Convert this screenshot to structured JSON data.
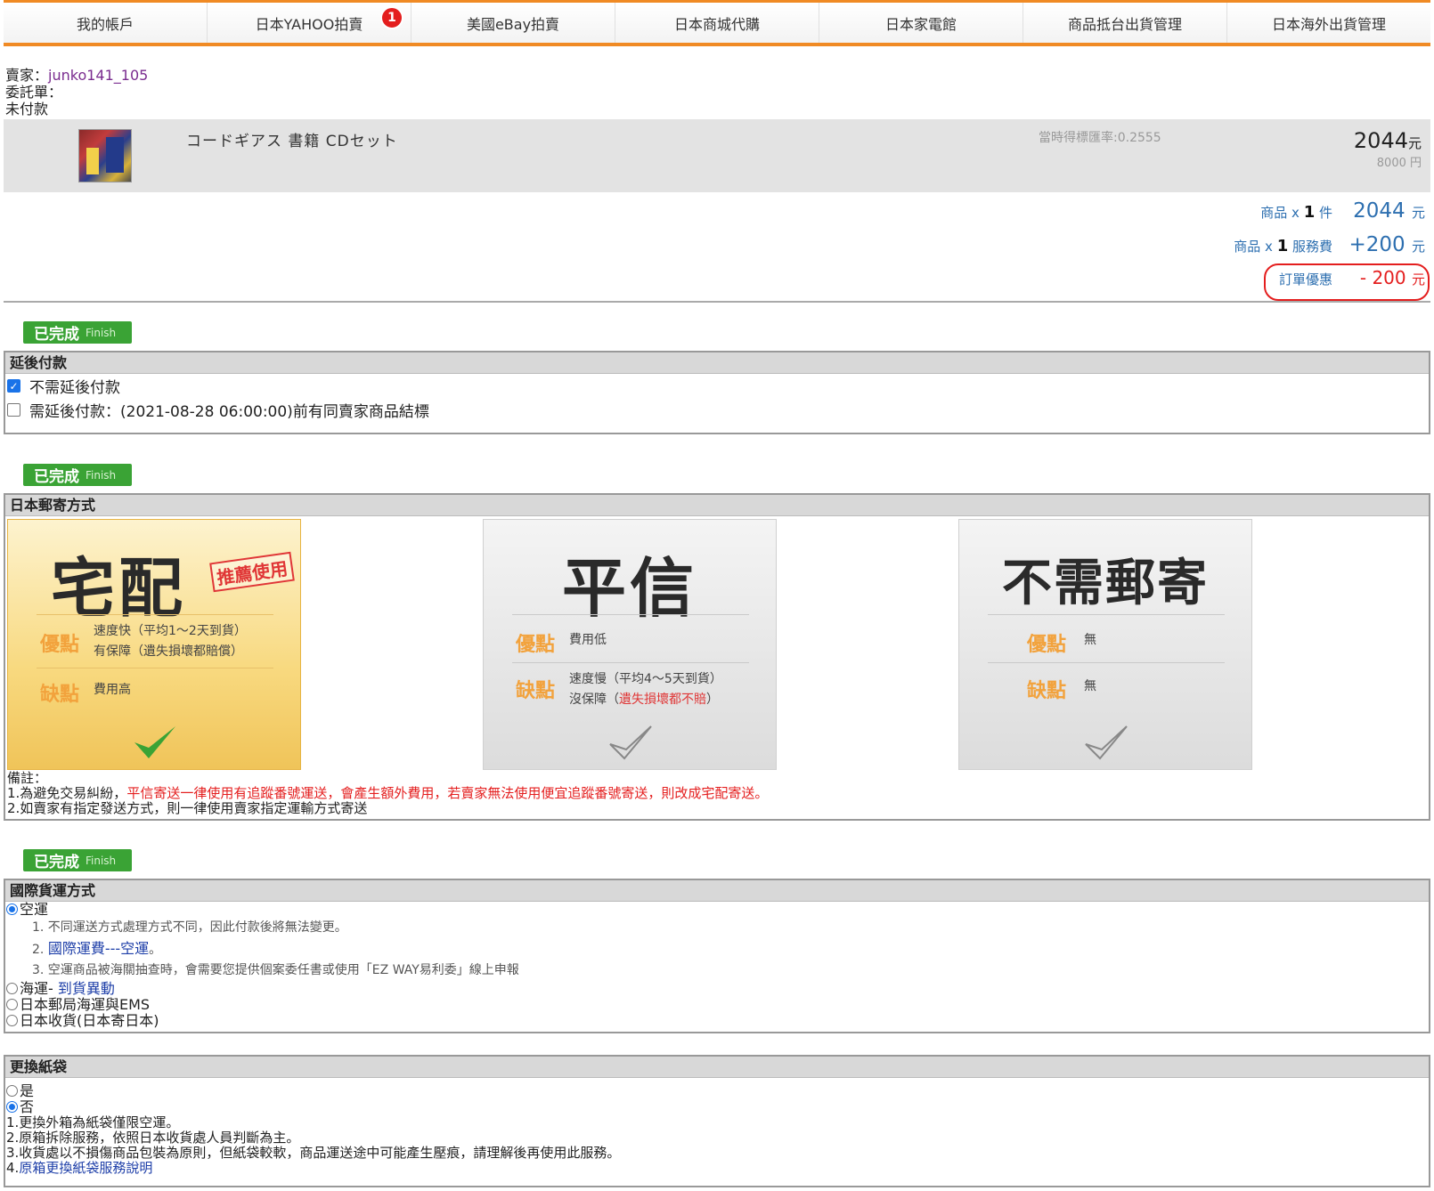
{
  "nav": {
    "items": [
      "我的帳戶",
      "日本YAHOO拍賣",
      "美國eBay拍賣",
      "日本商城代購",
      "日本家電館",
      "商品抵台出貨管理",
      "日本海外出貨管理"
    ],
    "badge": "1"
  },
  "seller": {
    "label": "賣家：",
    "name": "junko141_105",
    "consign": "委託單：",
    "status": "未付款"
  },
  "product": {
    "name": "コードギアス 書籍 CDセット",
    "rate": "當時得標匯率:0.2555",
    "price_rmb": "2044",
    "price_rmb_unit": "元",
    "price_jpy": "8000 円"
  },
  "totals": {
    "item_label_pre": "商品 x ",
    "item_qty": "1",
    "item_label_post": " 件",
    "item_value": "2044",
    "fee_label_pre": "商品 x ",
    "fee_qty": "1",
    "fee_label_post": " 服務費",
    "fee_value": "+200",
    "discount_label": "訂單優惠",
    "discount_value": "- 200",
    "unit": "元"
  },
  "finish": {
    "label": "已完成",
    "sub": "Finish"
  },
  "deferred": {
    "title": "延後付款",
    "opt1": "不需延後付款",
    "opt2": "需延後付款：(2021-08-28 06:00:00)前有同賣家商品結標"
  },
  "jp_shipping": {
    "title": "日本郵寄方式",
    "cards": [
      {
        "title": "宅配",
        "tag": "推薦使用",
        "pro_label": "優點",
        "pro_1": "速度快（平均1～2天到貨）",
        "pro_2": "有保障（遺失損壞都賠償）",
        "con_label": "缺點",
        "con_1": "費用高",
        "con_2": ""
      },
      {
        "title": "平信",
        "pro_label": "優點",
        "pro_1": "費用低",
        "con_label": "缺點",
        "con_1": "速度慢（平均4～5天到貨）",
        "con_2a": "沒保障（",
        "con_2b": "遺失損壞都不賠",
        "con_2c": "）"
      },
      {
        "title": "不需郵寄",
        "pro_label": "優點",
        "pro_1": "無",
        "con_label": "缺點",
        "con_1": "無"
      }
    ],
    "notes_title": "備註：",
    "note1_a": "1.為避免交易糾紛，",
    "note1_b": "平信寄送一律使用有追蹤番號運送，會產生額外費用，若賣家無法使用便宜追蹤番號寄送，則改成宅配寄送。",
    "note2": "2.如賣家有指定發送方式，則一律使用賣家指定運輸方式寄送"
  },
  "intl": {
    "title": "國際貨運方式",
    "air": "空運",
    "air_1": "1. 不同運送方式處理方式不同，因此付款後將無法變更。",
    "air_2_pre": "2. ",
    "air_2_link": "國際運費---空運",
    "air_2_post": "。",
    "air_3": "3. 空運商品被海關抽查時，會需要您提供個案委任書或使用「EZ WAY易利委」線上申報",
    "sea_pre": "海運- ",
    "sea_link": "到貨異動",
    "post": "日本郵局海運與EMS",
    "jp": "日本收貨(日本寄日本)"
  },
  "bag": {
    "title": "更換紙袋",
    "yes": "是",
    "no": "否",
    "n1": "1.更換外箱為紙袋僅限空運。",
    "n2": "2.原箱拆除服務，依照日本收貨處人員判斷為主。",
    "n3": "3.收貨處以不損傷商品包裝為原則，但紙袋較軟，商品運送途中可能產生壓痕，請理解後再使用此服務。",
    "n4_pre": "4.",
    "n4_link": "原箱更換紙袋服務說明"
  }
}
